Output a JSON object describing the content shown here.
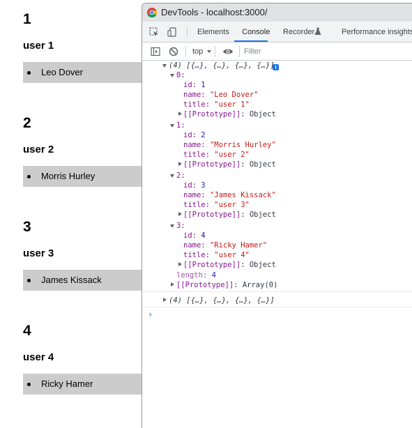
{
  "users": [
    {
      "number": "1",
      "title": "user 1",
      "name": "Leo Dover"
    },
    {
      "number": "2",
      "title": "user 2",
      "name": "Morris Hurley"
    },
    {
      "number": "3",
      "title": "user 3",
      "name": "James Kissack"
    },
    {
      "number": "4",
      "title": "user 4",
      "name": "Ricky Hamer"
    }
  ],
  "devtools": {
    "window_title": "DevTools - localhost:3000/",
    "tabs": [
      "Elements",
      "Console",
      "Recorder",
      "Performance insights"
    ],
    "active_tab": "Console",
    "context": "top",
    "filter_placeholder": "Filter",
    "icons": [
      "inspect-icon",
      "device-toggle-icon",
      "sidebar-toggle-icon",
      "clear-console-icon",
      "eye-icon",
      "recorder-flask-icon"
    ]
  },
  "console": {
    "summary": "(4) [{…}, {…}, {…}, {…}]",
    "collapsed_summary": "(4) [{…}, {…}, {…}, {…}]",
    "info_badge": "i",
    "entries": [
      {
        "index": "0:",
        "id": "1",
        "name": "\"Leo Dover\"",
        "title": "\"user 1\""
      },
      {
        "index": "1:",
        "id": "2",
        "name": "\"Morris Hurley\"",
        "title": "\"user 2\""
      },
      {
        "index": "2:",
        "id": "3",
        "name": "\"James Kissack\"",
        "title": "\"user 3\""
      },
      {
        "index": "3:",
        "id": "4",
        "name": "\"Ricky Hamer\"",
        "title": "\"user 4\""
      }
    ],
    "labels": {
      "id": "id: ",
      "name": "name: ",
      "title": "title: ",
      "prototype_key": "[[Prototype]]",
      "object_proto": ": Object",
      "array_proto": ": Array(0)",
      "length_key": "length",
      "length_value": "4"
    },
    "prompt": "›"
  },
  "colors": {
    "item_background": "#cccccc",
    "titlebar": "#dfe1e5",
    "accent": "#1a73e8",
    "key": "#881391",
    "string": "#c41a16",
    "number": "#1a1aa6"
  }
}
